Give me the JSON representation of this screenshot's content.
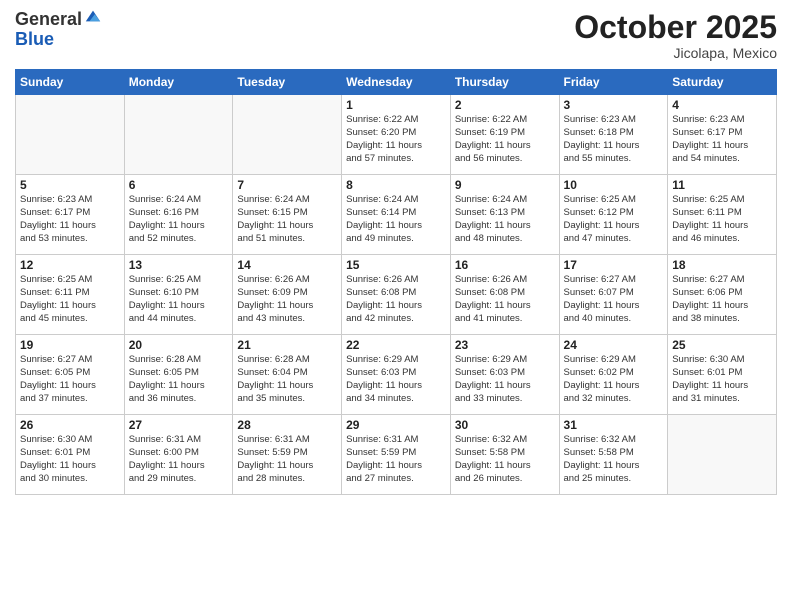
{
  "logo": {
    "general": "General",
    "blue": "Blue"
  },
  "header": {
    "month": "October 2025",
    "location": "Jicolapa, Mexico"
  },
  "weekdays": [
    "Sunday",
    "Monday",
    "Tuesday",
    "Wednesday",
    "Thursday",
    "Friday",
    "Saturday"
  ],
  "weeks": [
    [
      {
        "day": "",
        "info": ""
      },
      {
        "day": "",
        "info": ""
      },
      {
        "day": "",
        "info": ""
      },
      {
        "day": "1",
        "info": "Sunrise: 6:22 AM\nSunset: 6:20 PM\nDaylight: 11 hours\nand 57 minutes."
      },
      {
        "day": "2",
        "info": "Sunrise: 6:22 AM\nSunset: 6:19 PM\nDaylight: 11 hours\nand 56 minutes."
      },
      {
        "day": "3",
        "info": "Sunrise: 6:23 AM\nSunset: 6:18 PM\nDaylight: 11 hours\nand 55 minutes."
      },
      {
        "day": "4",
        "info": "Sunrise: 6:23 AM\nSunset: 6:17 PM\nDaylight: 11 hours\nand 54 minutes."
      }
    ],
    [
      {
        "day": "5",
        "info": "Sunrise: 6:23 AM\nSunset: 6:17 PM\nDaylight: 11 hours\nand 53 minutes."
      },
      {
        "day": "6",
        "info": "Sunrise: 6:24 AM\nSunset: 6:16 PM\nDaylight: 11 hours\nand 52 minutes."
      },
      {
        "day": "7",
        "info": "Sunrise: 6:24 AM\nSunset: 6:15 PM\nDaylight: 11 hours\nand 51 minutes."
      },
      {
        "day": "8",
        "info": "Sunrise: 6:24 AM\nSunset: 6:14 PM\nDaylight: 11 hours\nand 49 minutes."
      },
      {
        "day": "9",
        "info": "Sunrise: 6:24 AM\nSunset: 6:13 PM\nDaylight: 11 hours\nand 48 minutes."
      },
      {
        "day": "10",
        "info": "Sunrise: 6:25 AM\nSunset: 6:12 PM\nDaylight: 11 hours\nand 47 minutes."
      },
      {
        "day": "11",
        "info": "Sunrise: 6:25 AM\nSunset: 6:11 PM\nDaylight: 11 hours\nand 46 minutes."
      }
    ],
    [
      {
        "day": "12",
        "info": "Sunrise: 6:25 AM\nSunset: 6:11 PM\nDaylight: 11 hours\nand 45 minutes."
      },
      {
        "day": "13",
        "info": "Sunrise: 6:25 AM\nSunset: 6:10 PM\nDaylight: 11 hours\nand 44 minutes."
      },
      {
        "day": "14",
        "info": "Sunrise: 6:26 AM\nSunset: 6:09 PM\nDaylight: 11 hours\nand 43 minutes."
      },
      {
        "day": "15",
        "info": "Sunrise: 6:26 AM\nSunset: 6:08 PM\nDaylight: 11 hours\nand 42 minutes."
      },
      {
        "day": "16",
        "info": "Sunrise: 6:26 AM\nSunset: 6:08 PM\nDaylight: 11 hours\nand 41 minutes."
      },
      {
        "day": "17",
        "info": "Sunrise: 6:27 AM\nSunset: 6:07 PM\nDaylight: 11 hours\nand 40 minutes."
      },
      {
        "day": "18",
        "info": "Sunrise: 6:27 AM\nSunset: 6:06 PM\nDaylight: 11 hours\nand 38 minutes."
      }
    ],
    [
      {
        "day": "19",
        "info": "Sunrise: 6:27 AM\nSunset: 6:05 PM\nDaylight: 11 hours\nand 37 minutes."
      },
      {
        "day": "20",
        "info": "Sunrise: 6:28 AM\nSunset: 6:05 PM\nDaylight: 11 hours\nand 36 minutes."
      },
      {
        "day": "21",
        "info": "Sunrise: 6:28 AM\nSunset: 6:04 PM\nDaylight: 11 hours\nand 35 minutes."
      },
      {
        "day": "22",
        "info": "Sunrise: 6:29 AM\nSunset: 6:03 PM\nDaylight: 11 hours\nand 34 minutes."
      },
      {
        "day": "23",
        "info": "Sunrise: 6:29 AM\nSunset: 6:03 PM\nDaylight: 11 hours\nand 33 minutes."
      },
      {
        "day": "24",
        "info": "Sunrise: 6:29 AM\nSunset: 6:02 PM\nDaylight: 11 hours\nand 32 minutes."
      },
      {
        "day": "25",
        "info": "Sunrise: 6:30 AM\nSunset: 6:01 PM\nDaylight: 11 hours\nand 31 minutes."
      }
    ],
    [
      {
        "day": "26",
        "info": "Sunrise: 6:30 AM\nSunset: 6:01 PM\nDaylight: 11 hours\nand 30 minutes."
      },
      {
        "day": "27",
        "info": "Sunrise: 6:31 AM\nSunset: 6:00 PM\nDaylight: 11 hours\nand 29 minutes."
      },
      {
        "day": "28",
        "info": "Sunrise: 6:31 AM\nSunset: 5:59 PM\nDaylight: 11 hours\nand 28 minutes."
      },
      {
        "day": "29",
        "info": "Sunrise: 6:31 AM\nSunset: 5:59 PM\nDaylight: 11 hours\nand 27 minutes."
      },
      {
        "day": "30",
        "info": "Sunrise: 6:32 AM\nSunset: 5:58 PM\nDaylight: 11 hours\nand 26 minutes."
      },
      {
        "day": "31",
        "info": "Sunrise: 6:32 AM\nSunset: 5:58 PM\nDaylight: 11 hours\nand 25 minutes."
      },
      {
        "day": "",
        "info": ""
      }
    ]
  ]
}
